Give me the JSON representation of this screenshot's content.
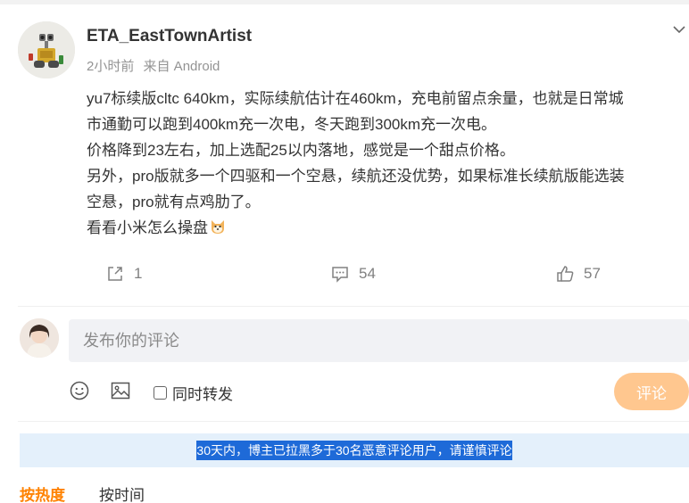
{
  "post": {
    "author": "ETA_EastTownArtist",
    "time": "2小时前",
    "source": "来自 Android",
    "lines": [
      "yu7标续版cltc 640km，实际续航估计在460km，充电前留点余量，也就是日常城",
      "市通勤可以跑到400km充一次电，冬天跑到300km充一次电。",
      "价格降到23左右，加上选配25以内落地，感觉是一个甜点价格。",
      "另外，pro版就多一个四驱和一个空悬，续航还没优势，如果标准长续航版能选装",
      "空悬，pro就有点鸡肋了。",
      "看看小米怎么操盘"
    ],
    "emoji": "dog-emoji"
  },
  "actions": {
    "repost_count": "1",
    "comment_count": "54",
    "like_count": "57"
  },
  "comment_box": {
    "placeholder": "发布你的评论",
    "repost_label": "同时转发",
    "submit_label": "评论"
  },
  "notice": "30天内，博主已拉黑多于30名恶意评论用户，请谨慎评论",
  "sort": {
    "hot": "按热度",
    "time": "按时间"
  },
  "colors": {
    "accent": "#ff8200",
    "submit_bg": "#ffc78f",
    "notice_bg": "#e4f0fb",
    "notice_highlight": "#1e6ad8"
  }
}
